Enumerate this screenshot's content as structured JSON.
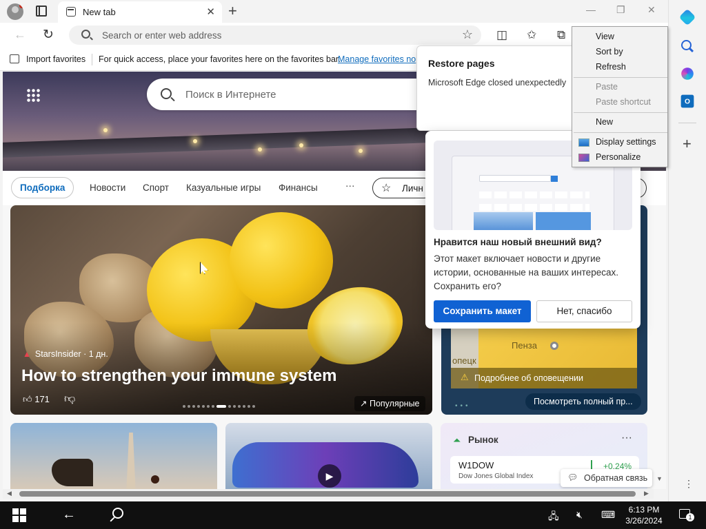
{
  "browser": {
    "tab_title": "New tab",
    "tab_close": "✕",
    "new_tab": "+",
    "window_min": "—",
    "window_max": "❐",
    "window_close": "✕",
    "address_placeholder": "Search or enter web address",
    "favorite_star": "☆"
  },
  "favorites_bar": {
    "import_label": "Import favorites",
    "message": "For quick access, place your favorites here on the favorites bar.",
    "manage_link": "Manage favorites no"
  },
  "hero": {
    "search_placeholder": "Поиск в Интернете"
  },
  "feed_nav": {
    "active": "Подборка",
    "items": [
      "Новости",
      "Спорт",
      "Казуальные игры",
      "Финансы"
    ],
    "more": "···",
    "personal": "Личн"
  },
  "main_card": {
    "source": "StarsInsider",
    "age": "· 1 дн.",
    "headline": "How to strengthen your immune system",
    "likes": "171",
    "popular_label": "Популярные"
  },
  "weather_card": {
    "city": "Пенза",
    "city_partial": "опецк",
    "alert": "Подробнее об оповещении",
    "view_full": "Посмотреть полный пр..."
  },
  "market_card": {
    "title": "Рынок",
    "more": "···",
    "symbol": "W1DOW",
    "index_name": "Dow Jones Global Index",
    "change": "+0.24%"
  },
  "feedback": {
    "label": "Обратная связь"
  },
  "restore_popup": {
    "title": "Restore pages",
    "message": "Microsoft Edge closed unexpectedly"
  },
  "new_look_popup": {
    "heading": "Нравится наш новый внешний вид?",
    "body": "Этот макет включает новости и другие истории, основанные на ваших интересах. Сохранить его?",
    "save_button": "Сохранить макет",
    "decline_button": "Нет, спасибо"
  },
  "context_menu": {
    "view": "View",
    "sort_by": "Sort by",
    "refresh": "Refresh",
    "paste": "Paste",
    "paste_shortcut": "Paste shortcut",
    "new": "New",
    "display_settings": "Display settings",
    "personalize": "Personalize"
  },
  "sidebar": {
    "outlook_letter": "O",
    "add": "+",
    "more": "⋮"
  },
  "taskbar": {
    "time": "6:13 PM",
    "date": "3/26/2024",
    "notification_count": "1"
  },
  "icons": {
    "profile": "profile-avatar-icon",
    "tabs": "vertical-tabs-icon",
    "back": "back-arrow-icon",
    "refresh": "refresh-icon",
    "split": "split-screen-icon",
    "favorites": "favorites-icon",
    "collections": "collections-icon",
    "copilot": "copilot-icon",
    "sidebar_search": "search-icon",
    "m365": "microsoft-365-icon",
    "outlook": "outlook-icon"
  },
  "colors": {
    "accent": "#0f6cbd",
    "save_button": "#1062d3",
    "positive": "#2fa04f",
    "alert_icon": "#ffd23f",
    "taskbar": "#101010"
  }
}
